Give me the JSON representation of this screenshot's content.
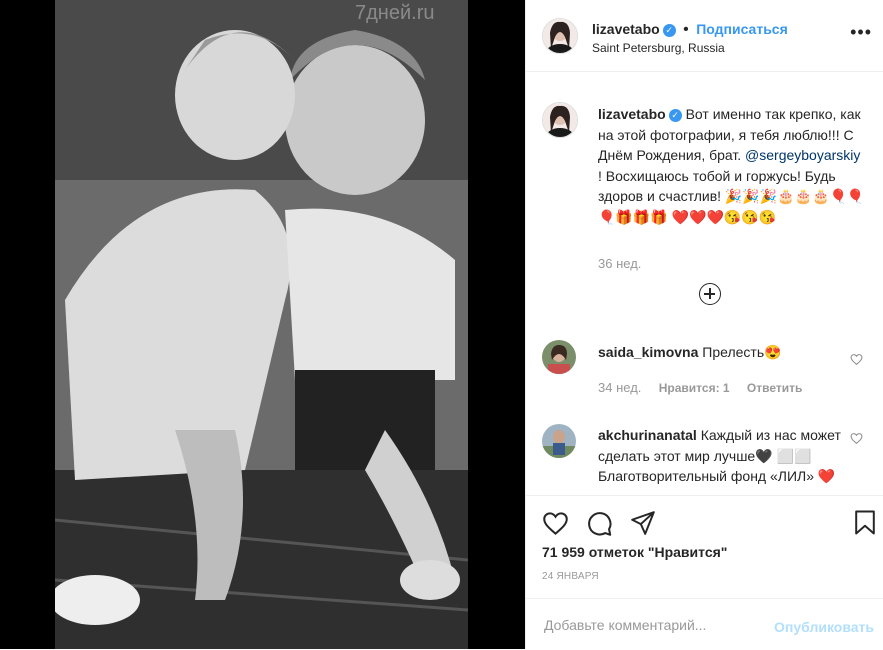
{
  "media": {
    "watermark": "7дней.ru"
  },
  "header": {
    "username": "lizavetabo",
    "follow": "Подписаться",
    "location": "Saint Petersburg, Russia",
    "more": "•••"
  },
  "caption": {
    "username": "lizavetabo",
    "text_1": "Вот именно так крепко, как на этой фотографии, я тебя люблю!!! С Днём Рождения, брат.",
    "mention": "@sergeyboyarskiy",
    "text_2": "! Восхищаюсь тобой и горжусь! Будь здоров и счастлив! 🎉🎉🎉🎂🎂🎂🎈🎈🎈🎁🎁🎁 ❤️❤️❤️😘😘😘",
    "time": "36 нед."
  },
  "comments": [
    {
      "username": "saida_kimovna",
      "text": "Прелесть😍",
      "time": "34 нед.",
      "likes": "Нравится: 1",
      "reply": "Ответить"
    },
    {
      "username": "akchurinanatal",
      "text": "Каждый из нас может сделать этот мир лучше🖤 ⬜⬜ Благотворительный фонд «ЛИЛ» ❤️@blagfond_live ❤️ посет"
    }
  ],
  "likes_text": "71 959 отметок \"Нравится\"",
  "date": "24 ЯНВАРЯ",
  "add_comment": {
    "placeholder": "Добавьте комментарий...",
    "publish": "Опубликовать"
  },
  "colors": {
    "link": "#3897f0",
    "mention": "#003569",
    "muted": "#999999"
  }
}
